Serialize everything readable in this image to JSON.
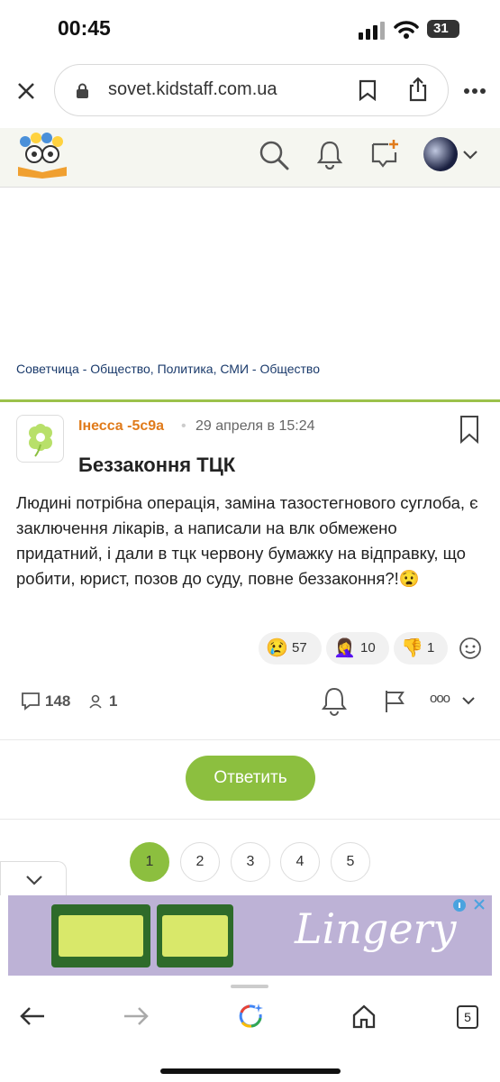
{
  "status": {
    "time": "00:45",
    "battery": "31"
  },
  "browser": {
    "url": "sovet.kidstaff.com.ua",
    "tab_count": "5"
  },
  "breadcrumb": "Советчица - Общество, Политика, СМИ - Общество",
  "post": {
    "author": "Інесса -5с9а",
    "separator": "•",
    "date": "29 апреля в 15:24",
    "title": "Беззаконня ТЦК",
    "body": "Людині потрібна операція, заміна тазостегнового суглоба, є заключення лікарів, а написали на влк обмежено придатний, і дали в тцк червону бумажку на відправку, що робити, юрист, позов до суду, повне беззаконня?!😧",
    "reactions": [
      {
        "emoji": "😢",
        "count": "57"
      },
      {
        "emoji": "🤦‍♀️",
        "count": "10"
      },
      {
        "emoji": "👎",
        "count": "1"
      }
    ],
    "comments_count": "148",
    "subscribers_count": "1",
    "more_label": "ooo"
  },
  "reply_label": "Ответить",
  "pagination": {
    "pages": [
      "1",
      "2",
      "3",
      "4",
      "5"
    ],
    "current": "1"
  },
  "ad": {
    "brand": "Lingery"
  },
  "colors": {
    "accent_green": "#8cbf3f",
    "author_orange": "#e07b1b",
    "link_blue": "#1a3a6b"
  }
}
